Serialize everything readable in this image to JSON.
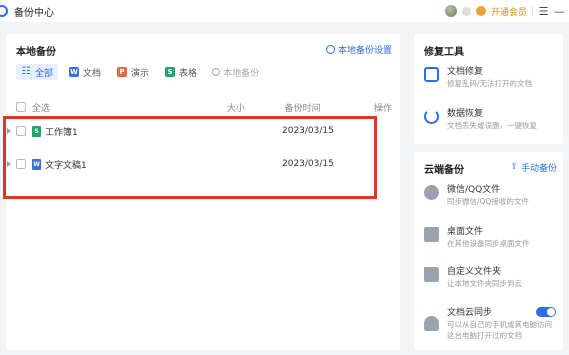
{
  "window": {
    "title": "备份中心",
    "vip_label": "开通会员"
  },
  "local": {
    "title": "本地备份",
    "settings_label": "本地备份设置",
    "filters": [
      {
        "icon": "all-icon",
        "label": "全部",
        "active": true
      },
      {
        "icon": "word-doc-icon",
        "label": "文档"
      },
      {
        "icon": "presentation-icon",
        "label": "演示"
      },
      {
        "icon": "spreadsheet-icon",
        "label": "表格"
      }
    ],
    "search_placeholder": "本地备份",
    "columns": {
      "select_all": "全选",
      "size": "大小",
      "time": "备份时间",
      "actions": "操作"
    },
    "files": [
      {
        "name": "工作簿1",
        "size": "",
        "time": "2023/03/15",
        "icon": "spreadsheet-file-icon"
      },
      {
        "name": "文字文稿1",
        "size": "",
        "time": "2023/03/15",
        "icon": "word-file-icon"
      }
    ]
  },
  "repair_tools": {
    "title": "修复工具",
    "items": [
      {
        "icon": "file-repair-icon",
        "title": "文档修复",
        "desc": "修复乱码/无法打开的文档"
      },
      {
        "icon": "data-recovery-icon",
        "title": "数据恢复",
        "desc": "文档丢失或误删，一键恢复"
      }
    ]
  },
  "cloud_backup": {
    "title": "云端备份",
    "manual_label": "手动备份",
    "items": [
      {
        "icon": "wechat-qq-icon",
        "title": "微信/QQ文件",
        "desc": "同步微信/QQ接收的文件"
      },
      {
        "icon": "desktop-icon",
        "title": "桌面文件",
        "desc": "在其他设备同步桌面文件"
      },
      {
        "icon": "folder-icon",
        "title": "自定义文件夹",
        "desc": "让本地文件夹同步到云"
      },
      {
        "icon": "cloud-sync-icon",
        "title": "文档云同步",
        "desc": "可以从自己的手机或其电脑访问这台电脑打开过的文档",
        "toggle_on": true
      }
    ]
  },
  "colors": {
    "accent": "#2d6ee6",
    "highlight": "#d9391c",
    "vip": "#d78b1c"
  }
}
